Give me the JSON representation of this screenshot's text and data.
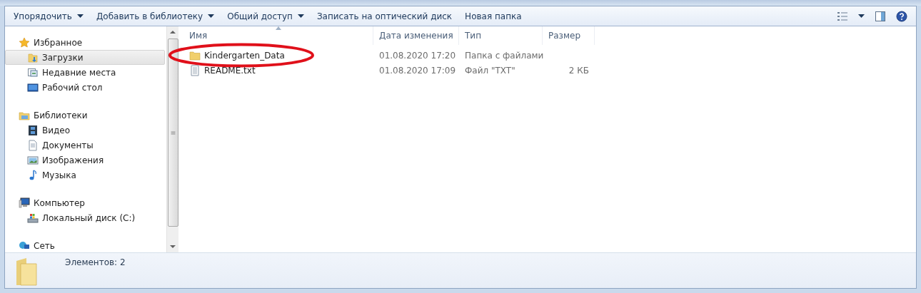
{
  "toolbar": {
    "items": [
      {
        "label": "Упорядочить",
        "dropdown": true
      },
      {
        "label": "Добавить в библиотеку",
        "dropdown": true
      },
      {
        "label": "Общий доступ",
        "dropdown": true
      },
      {
        "label": "Записать на оптический диск",
        "dropdown": false
      },
      {
        "label": "Новая папка",
        "dropdown": false
      }
    ]
  },
  "navigation": {
    "sections": [
      {
        "label": "Избранное",
        "selected": false,
        "children": [
          {
            "label": "Загрузки",
            "selected": true
          },
          {
            "label": "Недавние места",
            "selected": false
          },
          {
            "label": "Рабочий стол",
            "selected": false
          }
        ]
      },
      {
        "label": "Библиотеки",
        "selected": false,
        "children": [
          {
            "label": "Видео",
            "selected": false
          },
          {
            "label": "Документы",
            "selected": false
          },
          {
            "label": "Изображения",
            "selected": false
          },
          {
            "label": "Музыка",
            "selected": false
          }
        ]
      },
      {
        "label": "Компьютер",
        "selected": false,
        "children": [
          {
            "label": "Локальный диск (C:)",
            "selected": false
          }
        ]
      },
      {
        "label": "Сеть",
        "selected": false
      }
    ]
  },
  "file_list": {
    "columns": [
      {
        "label": "Имя",
        "sorted": true
      },
      {
        "label": "Дата изменения",
        "sorted": false
      },
      {
        "label": "Тип",
        "sorted": false
      },
      {
        "label": "Размер",
        "sorted": false
      }
    ],
    "rows": [
      {
        "kind": "folder",
        "name": "Kindergarten_Data",
        "modified": "01.08.2020 17:20",
        "type": "Папка с файлами",
        "circled": true
      },
      {
        "kind": "text",
        "name": "README.txt",
        "modified": "01.08.2020 17:09",
        "type": "Файл \"TXT\"",
        "size": "2 КБ",
        "circled": false
      }
    ]
  },
  "status_bar": {
    "text": "Элементов: 2"
  }
}
